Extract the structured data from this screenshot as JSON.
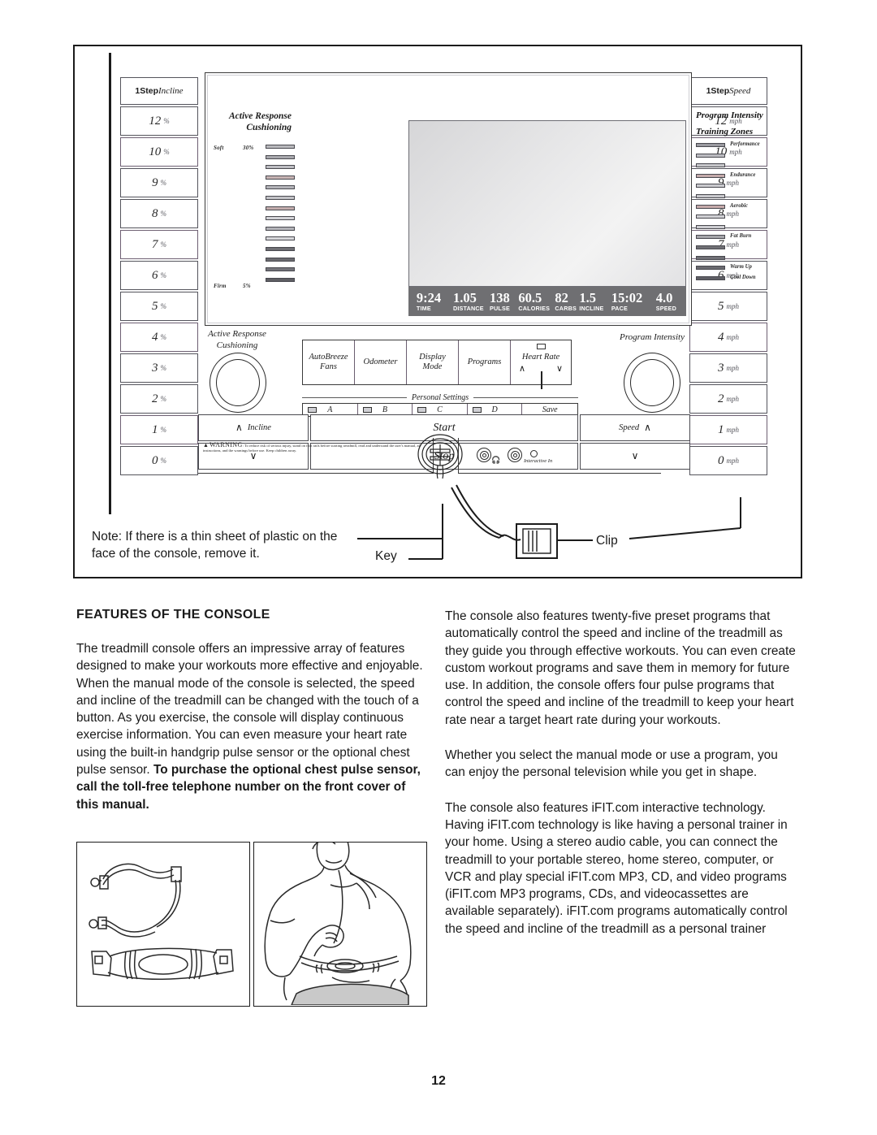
{
  "page": {
    "number": "12"
  },
  "illustration": {
    "note": "Note: If there is a thin sheet of plastic on the face of the console, remove it.",
    "callouts": {
      "key": "Key",
      "clip": "Clip"
    },
    "incline_ladder": {
      "header_bold": "1Step",
      "header_italic": "Incline",
      "unit": "%",
      "values": [
        "12",
        "10",
        "9",
        "8",
        "7",
        "6",
        "5",
        "4",
        "3",
        "2",
        "1",
        "0"
      ]
    },
    "speed_ladder": {
      "header_bold": "1Step",
      "header_italic": "Speed",
      "unit": "mph",
      "values": [
        "12",
        "10",
        "9",
        "8",
        "7",
        "6",
        "5",
        "4",
        "3",
        "2",
        "1",
        "0"
      ]
    },
    "cushioning": {
      "title": "Active Response\nCushioning",
      "soft_label": "Soft",
      "soft_value": "30%",
      "firm_label": "Firm",
      "firm_value": "5%",
      "segments": 14
    },
    "program_intensity": {
      "title": "Program Intensity",
      "subtitle": "Training Zones",
      "zones": [
        "Performance",
        "Endurance",
        "Aerobic",
        "Fat Burn",
        "Warm Up",
        "Cool Down"
      ],
      "segments": 14
    },
    "display_readout": [
      {
        "value": "9:24",
        "label": "TIME"
      },
      {
        "value": "1.05",
        "label": "DISTANCE"
      },
      {
        "value": "138",
        "label": "PULSE"
      },
      {
        "value": "60.5",
        "label": "CALORIES"
      },
      {
        "value": "82",
        "label": "CARBS"
      },
      {
        "value": "1.5",
        "label": "INCLINE"
      },
      {
        "value": "15:02",
        "label": "PACE"
      },
      {
        "value": "4.0",
        "label": "SPEED"
      }
    ],
    "function_buttons": [
      "AutoBreeze\nFans",
      "Odometer",
      "Display\nMode",
      "Programs"
    ],
    "heart_rate_button": {
      "label": "Heart Rate",
      "up": "∧",
      "down": "∨"
    },
    "personal_settings": {
      "title": "Personal Settings",
      "buttons": [
        "A",
        "B",
        "C",
        "D"
      ],
      "save": "Save"
    },
    "dials": {
      "left": "Active Response\nCushioning",
      "right": "Program Intensity"
    },
    "controls": {
      "incline_up": "Incline",
      "incline_up_chevron": "∧",
      "incline_down_chevron": "∨",
      "start": "Start",
      "stop": "Stop",
      "speed_up": "Speed",
      "speed_up_chevron": "∧",
      "speed_down_chevron": "∨"
    },
    "warning": {
      "heading": "WARNING",
      "text": ": To reduce risk of serious injury, stand on foot rails before starting treadmill, read and understand the user's manual, all instructions, and the warnings before use.  Keep children away."
    },
    "jacks": {
      "headphone_icon": "headphone-icon",
      "interactive_in": "Interactive In"
    }
  },
  "content": {
    "section_title": "FEATURES OF THE CONSOLE",
    "left_paragraph_normal": "The treadmill console offers an impressive array of features designed to make your workouts more effective and enjoyable. When the manual mode of the console is selected, the speed and incline of the treadmill can be changed with the touch of a button. As you exercise, the console will display continuous exercise information. You can even measure your heart rate using the built-in handgrip pulse sensor or the optional chest pulse sensor. ",
    "left_paragraph_bold": "To purchase the optional chest pulse sensor, call the toll-free telephone number on the front cover of this manual.",
    "right_paragraph_1": "The console also features twenty-five preset programs that automatically control the speed and incline of the treadmill as they guide you through effective workouts. You can even create custom workout programs and save them in memory for future use. In addition, the console offers four pulse programs that control the speed and incline of the treadmill to keep your heart rate near a target heart rate during your workouts.",
    "right_paragraph_2": "Whether you select the manual mode or use a program, you can enjoy the personal television while you get in shape.",
    "right_paragraph_3": "The console also features iFIT.com interactive technology. Having iFIT.com technology is like having a personal trainer in your home. Using a stereo audio cable, you can connect the treadmill to your portable stereo, home stereo, computer, or VCR and play special iFIT.com MP3, CD, and video programs (iFIT.com MP3 programs, CDs, and videocassettes are available separately). iFIT.com programs automatically control the speed and incline of the treadmill as a personal trainer"
  }
}
